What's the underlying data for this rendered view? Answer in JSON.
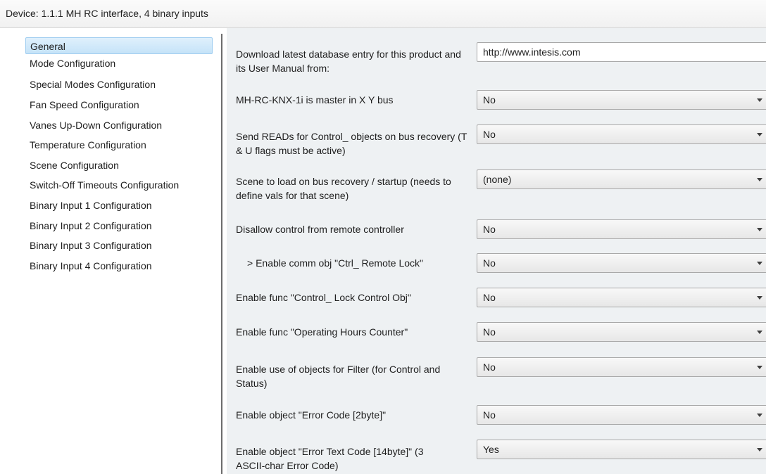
{
  "device_title": "Device: 1.1.1  MH RC interface, 4 binary inputs",
  "sidebar": {
    "items": [
      {
        "label": "General",
        "selected": true
      },
      {
        "label": "Mode Configuration"
      },
      {
        "label": "Special Modes Configuration"
      },
      {
        "label": "Fan Speed Configuration"
      },
      {
        "label": "Vanes Up-Down Configuration"
      },
      {
        "label": "Temperature Configuration"
      },
      {
        "label": "Scene Configuration"
      },
      {
        "label": "Switch-Off Timeouts Configuration"
      },
      {
        "label": "Binary Input 1 Configuration"
      },
      {
        "label": "Binary Input 2 Configuration"
      },
      {
        "label": "Binary Input 3 Configuration"
      },
      {
        "label": "Binary Input 4 Configuration"
      }
    ]
  },
  "params": [
    {
      "label": "Download latest database entry for this product and its User Manual from:",
      "value": "http://www.intesis.com",
      "kind": "text"
    },
    {
      "label": "MH-RC-KNX-1i is master in X Y bus",
      "value": "No",
      "kind": "dropdown"
    },
    {
      "label": "Send READs for Control_ objects on bus recovery (T & U flags must be active)",
      "value": "No",
      "kind": "dropdown"
    },
    {
      "label": "Scene to load on bus recovery / startup (needs to define vals for that scene)",
      "value": "(none)",
      "kind": "dropdown"
    },
    {
      "label": "Disallow control from remote controller",
      "value": "No",
      "kind": "dropdown"
    },
    {
      "label": "    > Enable comm obj \"Ctrl_ Remote Lock\"",
      "value": "No",
      "kind": "dropdown"
    },
    {
      "label": "Enable func \"Control_ Lock Control Obj\"",
      "value": "No",
      "kind": "dropdown"
    },
    {
      "label": "Enable func \"Operating Hours Counter\"",
      "value": "No",
      "kind": "dropdown"
    },
    {
      "label": "Enable use of objects for Filter (for Control and Status)",
      "value": "No",
      "kind": "dropdown"
    },
    {
      "label": "Enable object \"Error Code [2byte]\"",
      "value": "No",
      "kind": "dropdown"
    },
    {
      "label": "Enable object \"Error Text Code [14byte]\" (3 ASCII-char Error Code)",
      "value": "Yes",
      "kind": "dropdown"
    }
  ],
  "colors": {
    "content_bg": "#eef1f3",
    "selected_bg": "#c5e3f8",
    "selected_border": "#9fcdf0"
  }
}
